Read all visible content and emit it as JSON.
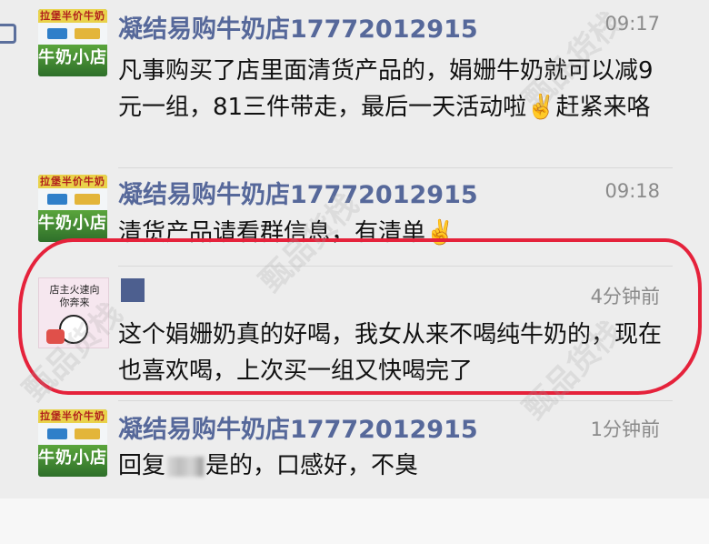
{
  "feed": {
    "messages": [
      {
        "name": "凝结易购牛奶店17772012915",
        "time": "09:17",
        "text": "凡事购买了店里面清货产品的，娟姗牛奶就可以减9元一组，81三件带走，最后一天活动啦✌️赶紧来咯",
        "avatar_top": "拉堡半价牛奶",
        "avatar_big": "牛奶小店"
      },
      {
        "name": "凝结易购牛奶店17772012915",
        "time": "09:18",
        "text": "清货产品请看群信息，有清单✌️",
        "avatar_top": "拉堡半价牛奶",
        "avatar_big": "牛奶小店"
      },
      {
        "time": "4分钟前",
        "text": "这个娟姗奶真的好喝，我女从来不喝纯牛奶的，现在也喜欢喝，上次买一组又快喝完了",
        "avatar_caption": "店主火速向你奔来"
      },
      {
        "name": "凝结易购牛奶店17772012915",
        "time": "1分钟前",
        "reply_prefix": "回复",
        "reply_text": "是的，口感好，不臭",
        "avatar_top": "拉堡半价牛奶",
        "avatar_big": "牛奶小店"
      }
    ]
  },
  "watermark": "甄品货栈",
  "colors": {
    "name": "#56689a",
    "highlight": "#e5223b",
    "background": "#ededed"
  }
}
